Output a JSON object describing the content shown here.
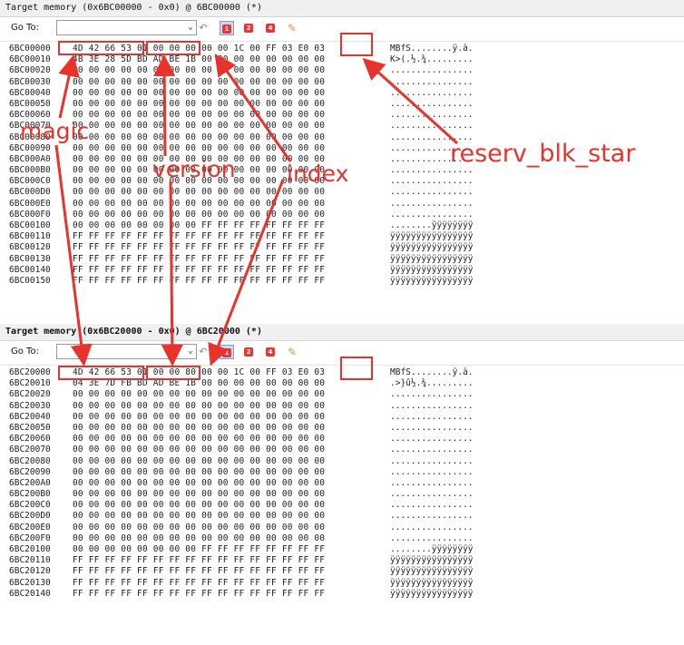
{
  "panes": [
    {
      "title": "Target memory (0x6BC00000 - 0x0) @ 6BC00000 (*)",
      "goto_label": "Go To:",
      "goto_value": "",
      "rows": [
        {
          "addr": "6BC00000",
          "bytes": "4D 42 66 53 01 00 00 00 00 00 1C 00 FF 03 E0 03",
          "ascii": "MBfS........ÿ.à."
        },
        {
          "addr": "6BC00010",
          "bytes": "4B 3E 28 5D BD AD BE 1B 00 00 00 00 00 00 00 00",
          "ascii": "K>(.½.¾........."
        },
        {
          "addr": "6BC00020",
          "bytes": "00 00 00 00 00 00 00 00 00 00 00 00 00 00 00 00",
          "ascii": "................"
        },
        {
          "addr": "6BC00030",
          "bytes": "00 00 00 00 00 00 00 00 00 00 00 00 00 00 00 00",
          "ascii": "................"
        },
        {
          "addr": "6BC00040",
          "bytes": "00 00 00 00 00 00 00 00 00 00 00 00 00 00 00 00",
          "ascii": "................"
        },
        {
          "addr": "6BC00050",
          "bytes": "00 00 00 00 00 00 00 00 00 00 00 00 00 00 00 00",
          "ascii": "................"
        },
        {
          "addr": "6BC00060",
          "bytes": "00 00 00 00 00 00 00 00 00 00 00 00 00 00 00 00",
          "ascii": "................"
        },
        {
          "addr": "6BC00070",
          "bytes": "00 00 00 00 00 00 00 00 00 00 00 00 00 00 00 00",
          "ascii": "................"
        },
        {
          "addr": "6BC00080",
          "bytes": "00 00 00 00 00 00 00 00 00 00 00 00 00 00 00 00",
          "ascii": "................"
        },
        {
          "addr": "6BC00090",
          "bytes": "00 00 00 00 00 00 00 00 00 00 00 00 00 00 00 00",
          "ascii": "................"
        },
        {
          "addr": "6BC000A0",
          "bytes": "00 00 00 00 00 00 00 00 00 00 00 00 00 00 00 00",
          "ascii": "................"
        },
        {
          "addr": "6BC000B0",
          "bytes": "00 00 00 00 00 00 00 00 00 00 00 00 00 00 00 00",
          "ascii": "................"
        },
        {
          "addr": "6BC000C0",
          "bytes": "00 00 00 00 00 00 00 00 00 00 00 00 00 00 00 00",
          "ascii": "................"
        },
        {
          "addr": "6BC000D0",
          "bytes": "00 00 00 00 00 00 00 00 00 00 00 00 00 00 00 00",
          "ascii": "................"
        },
        {
          "addr": "6BC000E0",
          "bytes": "00 00 00 00 00 00 00 00 00 00 00 00 00 00 00 00",
          "ascii": "................"
        },
        {
          "addr": "6BC000F0",
          "bytes": "00 00 00 00 00 00 00 00 00 00 00 00 00 00 00 00",
          "ascii": "................"
        },
        {
          "addr": "6BC00100",
          "bytes": "00 00 00 00 00 00 00 00 FF FF FF FF FF FF FF FF",
          "ascii": "........ÿÿÿÿÿÿÿÿ"
        },
        {
          "addr": "6BC00110",
          "bytes": "FF FF FF FF FF FF FF FF FF FF FF FF FF FF FF FF",
          "ascii": "ÿÿÿÿÿÿÿÿÿÿÿÿÿÿÿÿ"
        },
        {
          "addr": "6BC00120",
          "bytes": "FF FF FF FF FF FF FF FF FF FF FF FF FF FF FF FF",
          "ascii": "ÿÿÿÿÿÿÿÿÿÿÿÿÿÿÿÿ"
        },
        {
          "addr": "6BC00130",
          "bytes": "FF FF FF FF FF FF FF FF FF FF FF FF FF FF FF FF",
          "ascii": "ÿÿÿÿÿÿÿÿÿÿÿÿÿÿÿÿ"
        },
        {
          "addr": "6BC00140",
          "bytes": "FF FF FF FF FF FF FF FF FF FF FF FF FF FF FF FF",
          "ascii": "ÿÿÿÿÿÿÿÿÿÿÿÿÿÿÿÿ"
        },
        {
          "addr": "6BC00150",
          "bytes": "FF FF FF FF FF FF FF FF FF FF FF FF FF FF FF FF",
          "ascii": "ÿÿÿÿÿÿÿÿÿÿÿÿÿÿÿÿ"
        }
      ]
    },
    {
      "title": "Target memory (0x6BC20000 - 0x0) @ 6BC20000 (*)",
      "goto_label": "Go To:",
      "goto_value": "",
      "rows": [
        {
          "addr": "6BC20000",
          "bytes": "4D 42 66 53 01 00 00 80 00 00 1C 00 FF 03 E0 03",
          "ascii": "MBfS........ÿ.à."
        },
        {
          "addr": "6BC20010",
          "bytes": "04 3E 7D FB BD AD BE 1B 00 00 00 00 00 00 00 00",
          "ascii": ".>}û½.¾........."
        },
        {
          "addr": "6BC20020",
          "bytes": "00 00 00 00 00 00 00 00 00 00 00 00 00 00 00 00",
          "ascii": "................"
        },
        {
          "addr": "6BC20030",
          "bytes": "00 00 00 00 00 00 00 00 00 00 00 00 00 00 00 00",
          "ascii": "................"
        },
        {
          "addr": "6BC20040",
          "bytes": "00 00 00 00 00 00 00 00 00 00 00 00 00 00 00 00",
          "ascii": "................"
        },
        {
          "addr": "6BC20050",
          "bytes": "00 00 00 00 00 00 00 00 00 00 00 00 00 00 00 00",
          "ascii": "................"
        },
        {
          "addr": "6BC20060",
          "bytes": "00 00 00 00 00 00 00 00 00 00 00 00 00 00 00 00",
          "ascii": "................"
        },
        {
          "addr": "6BC20070",
          "bytes": "00 00 00 00 00 00 00 00 00 00 00 00 00 00 00 00",
          "ascii": "................"
        },
        {
          "addr": "6BC20080",
          "bytes": "00 00 00 00 00 00 00 00 00 00 00 00 00 00 00 00",
          "ascii": "................"
        },
        {
          "addr": "6BC20090",
          "bytes": "00 00 00 00 00 00 00 00 00 00 00 00 00 00 00 00",
          "ascii": "................"
        },
        {
          "addr": "6BC200A0",
          "bytes": "00 00 00 00 00 00 00 00 00 00 00 00 00 00 00 00",
          "ascii": "................"
        },
        {
          "addr": "6BC200B0",
          "bytes": "00 00 00 00 00 00 00 00 00 00 00 00 00 00 00 00",
          "ascii": "................"
        },
        {
          "addr": "6BC200C0",
          "bytes": "00 00 00 00 00 00 00 00 00 00 00 00 00 00 00 00",
          "ascii": "................"
        },
        {
          "addr": "6BC200D0",
          "bytes": "00 00 00 00 00 00 00 00 00 00 00 00 00 00 00 00",
          "ascii": "................"
        },
        {
          "addr": "6BC200E0",
          "bytes": "00 00 00 00 00 00 00 00 00 00 00 00 00 00 00 00",
          "ascii": "................"
        },
        {
          "addr": "6BC200F0",
          "bytes": "00 00 00 00 00 00 00 00 00 00 00 00 00 00 00 00",
          "ascii": "................"
        },
        {
          "addr": "6BC20100",
          "bytes": "00 00 00 00 00 00 00 00 FF FF FF FF FF FF FF FF",
          "ascii": "........ÿÿÿÿÿÿÿÿ"
        },
        {
          "addr": "6BC20110",
          "bytes": "FF FF FF FF FF FF FF FF FF FF FF FF FF FF FF FF",
          "ascii": "ÿÿÿÿÿÿÿÿÿÿÿÿÿÿÿÿ"
        },
        {
          "addr": "6BC20120",
          "bytes": "FF FF FF FF FF FF FF FF FF FF FF FF FF FF FF FF",
          "ascii": "ÿÿÿÿÿÿÿÿÿÿÿÿÿÿÿÿ"
        },
        {
          "addr": "6BC20130",
          "bytes": "FF FF FF FF FF FF FF FF FF FF FF FF FF FF FF FF",
          "ascii": "ÿÿÿÿÿÿÿÿÿÿÿÿÿÿÿÿ"
        },
        {
          "addr": "6BC20140",
          "bytes": "FF FF FF FF FF FF FF FF FF FF FF FF FF FF FF FF",
          "ascii": "ÿÿÿÿÿÿÿÿÿÿÿÿÿÿÿÿ"
        }
      ]
    }
  ],
  "toolbar_icons": [
    "back-arrow-icon",
    "bookmark-1-icon",
    "bookmark-2-icon",
    "bookmark-4-icon",
    "edit-notes-icon"
  ],
  "toolbar_labels": {
    "b1": "1",
    "b2": "2",
    "b4": "4"
  },
  "annotations": {
    "magic": "magic",
    "version": "version",
    "index": "index",
    "reserv": "reserv_blk_star",
    "color": "#e8322c"
  }
}
